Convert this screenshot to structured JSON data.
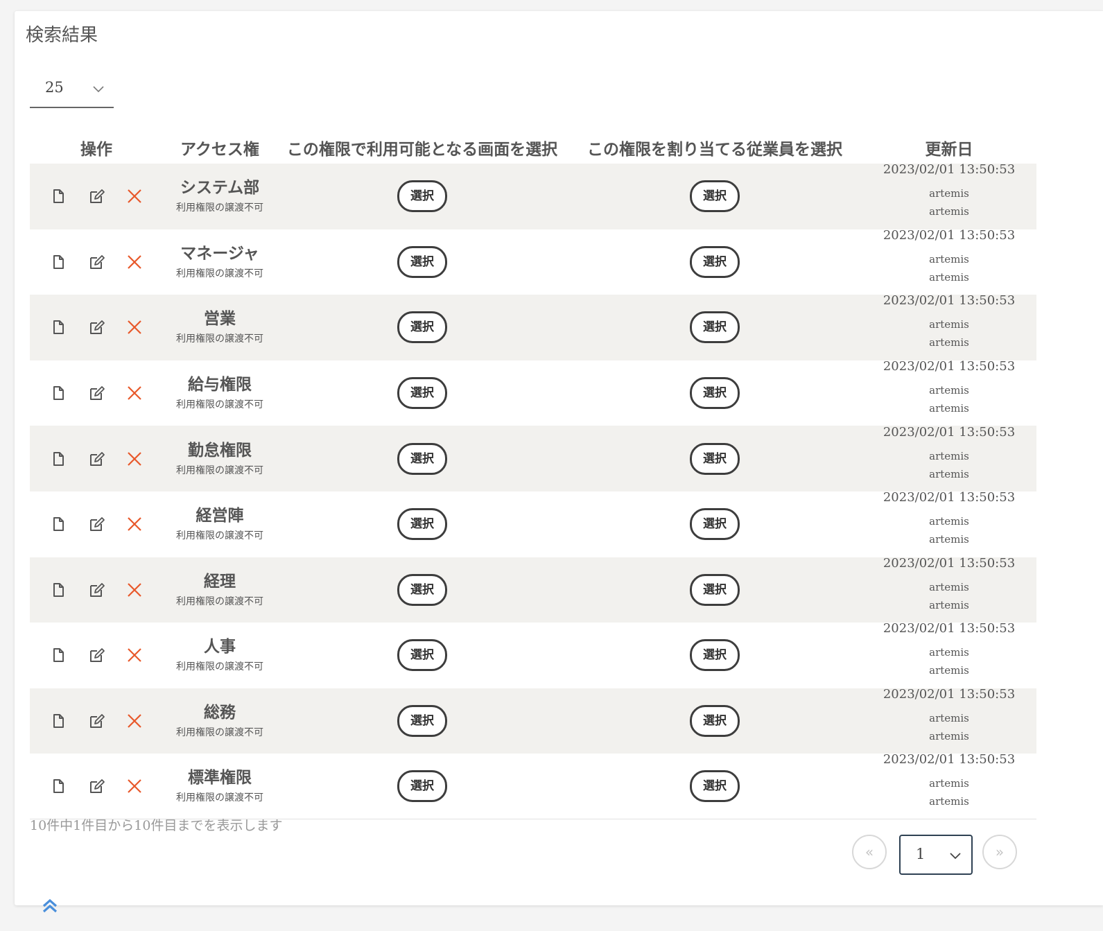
{
  "title": "検索結果",
  "per_page": {
    "value": "25"
  },
  "columns": {
    "ops": "操作",
    "access": "アクセス権",
    "screens": "この権限で利用可能となる画面を選択",
    "employees": "この権限を割り当てる従業員を選択",
    "updated": "更新日"
  },
  "select_label": "選択",
  "rows": [
    {
      "name": "システム部",
      "note": "利用権限の譲渡不可",
      "date": "2023/02/01 13:50:53",
      "user1": "artemis",
      "user2": "artemis"
    },
    {
      "name": "マネージャ",
      "note": "利用権限の譲渡不可",
      "date": "2023/02/01 13:50:53",
      "user1": "artemis",
      "user2": "artemis"
    },
    {
      "name": "営業",
      "note": "利用権限の譲渡不可",
      "date": "2023/02/01 13:50:53",
      "user1": "artemis",
      "user2": "artemis"
    },
    {
      "name": "給与権限",
      "note": "利用権限の譲渡不可",
      "date": "2023/02/01 13:50:53",
      "user1": "artemis",
      "user2": "artemis"
    },
    {
      "name": "勤怠権限",
      "note": "利用権限の譲渡不可",
      "date": "2023/02/01 13:50:53",
      "user1": "artemis",
      "user2": "artemis"
    },
    {
      "name": "経営陣",
      "note": "利用権限の譲渡不可",
      "date": "2023/02/01 13:50:53",
      "user1": "artemis",
      "user2": "artemis"
    },
    {
      "name": "経理",
      "note": "利用権限の譲渡不可",
      "date": "2023/02/01 13:50:53",
      "user1": "artemis",
      "user2": "artemis"
    },
    {
      "name": "人事",
      "note": "利用権限の譲渡不可",
      "date": "2023/02/01 13:50:53",
      "user1": "artemis",
      "user2": "artemis"
    },
    {
      "name": "総務",
      "note": "利用権限の譲渡不可",
      "date": "2023/02/01 13:50:53",
      "user1": "artemis",
      "user2": "artemis"
    },
    {
      "name": "標準権限",
      "note": "利用権限の譲渡不可",
      "date": "2023/02/01 13:50:53",
      "user1": "artemis",
      "user2": "artemis"
    }
  ],
  "summary": "10件中1件目から10件目までを表示します",
  "pagination": {
    "prev": "«",
    "current": "1",
    "next": "»"
  },
  "icons": {
    "view": "document-icon",
    "edit": "edit-icon",
    "delete": "close-icon",
    "back_to_top": "double-chevron-up-icon"
  },
  "colors": {
    "delete": "#e8582a",
    "row_alt": "#f2f1ee",
    "back_to_top": "#4a8fdb",
    "page_select_border": "#2f4153"
  }
}
